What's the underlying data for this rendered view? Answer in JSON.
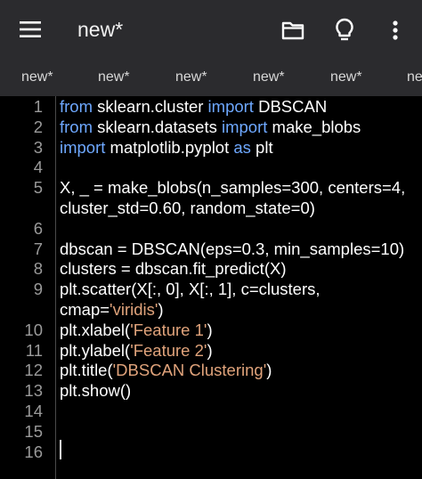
{
  "app": {
    "title": "new*",
    "icons": [
      "menu-icon",
      "folder-icon",
      "lightbulb-icon",
      "more-vert-icon"
    ]
  },
  "tabs": [
    "new*",
    "new*",
    "new*",
    "new*",
    "new*",
    "ne"
  ],
  "editor": {
    "line_numbers": [
      "1",
      "2",
      "3",
      "4",
      "5",
      "",
      "6",
      "7",
      "8",
      "9",
      "",
      "10",
      "11",
      "12",
      "13",
      "14",
      "15",
      "16"
    ],
    "lines": [
      {
        "n": "1",
        "parts": [
          {
            "t": "from",
            "k": "kw"
          },
          {
            "t": " sklearn.cluster ",
            "k": ""
          },
          {
            "t": "import",
            "k": "kw"
          },
          {
            "t": " DBSCAN",
            "k": ""
          }
        ]
      },
      {
        "n": "2",
        "parts": [
          {
            "t": "from",
            "k": "kw"
          },
          {
            "t": " sklearn.datasets ",
            "k": ""
          },
          {
            "t": "import",
            "k": "kw"
          },
          {
            "t": " make_blobs",
            "k": ""
          }
        ]
      },
      {
        "n": "3",
        "parts": [
          {
            "t": "import",
            "k": "kw"
          },
          {
            "t": " matplotlib.pyplot ",
            "k": ""
          },
          {
            "t": "as",
            "k": "kw"
          },
          {
            "t": " plt",
            "k": ""
          }
        ]
      },
      {
        "n": "4",
        "parts": []
      },
      {
        "n": "5",
        "parts": [
          {
            "t": "X, _ = make_blobs(n_samples=300, centers=4,",
            "k": ""
          }
        ]
      },
      {
        "n": "",
        "parts": [
          {
            "t": "cluster_std=0.60, random_state=0)",
            "k": ""
          }
        ]
      },
      {
        "n": "6",
        "parts": []
      },
      {
        "n": "7",
        "parts": [
          {
            "t": "dbscan = DBSCAN(eps=0.3, min_samples=10)",
            "k": ""
          }
        ]
      },
      {
        "n": "8",
        "parts": [
          {
            "t": "clusters = dbscan.fit_predict(X)",
            "k": ""
          }
        ]
      },
      {
        "n": "9",
        "parts": [
          {
            "t": "plt.scatter(X[:, 0], X[:, 1], c=clusters,",
            "k": ""
          }
        ]
      },
      {
        "n": "",
        "parts": [
          {
            "t": "cmap=",
            "k": ""
          },
          {
            "t": "'viridis'",
            "k": "str"
          },
          {
            "t": ")",
            "k": ""
          }
        ]
      },
      {
        "n": "10",
        "parts": [
          {
            "t": "plt.xlabel(",
            "k": ""
          },
          {
            "t": "'Feature 1'",
            "k": "str"
          },
          {
            "t": ")",
            "k": ""
          }
        ]
      },
      {
        "n": "11",
        "parts": [
          {
            "t": "plt.ylabel(",
            "k": ""
          },
          {
            "t": "'Feature 2'",
            "k": "str"
          },
          {
            "t": ")",
            "k": ""
          }
        ]
      },
      {
        "n": "12",
        "parts": [
          {
            "t": "plt.title(",
            "k": ""
          },
          {
            "t": "'DBSCAN Clustering'",
            "k": "str"
          },
          {
            "t": ")",
            "k": ""
          }
        ]
      },
      {
        "n": "13",
        "parts": [
          {
            "t": "plt.show()",
            "k": ""
          }
        ]
      },
      {
        "n": "14",
        "parts": []
      },
      {
        "n": "15",
        "parts": []
      },
      {
        "n": "16",
        "parts": []
      }
    ]
  },
  "colors": {
    "background": "#000000",
    "toolbar": "#2b2b2e",
    "keyword": "#6ea8ff",
    "string": "#e0a37b",
    "line_number": "#9a9a9a"
  }
}
